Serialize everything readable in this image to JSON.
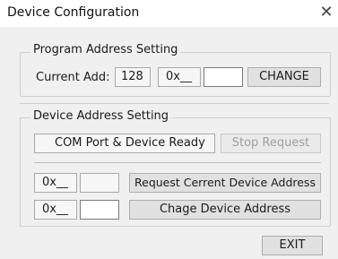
{
  "window": {
    "title": "Device Configuration",
    "close_label": "✕"
  },
  "program_group": {
    "title": "Program Address Setting",
    "current_label": "Current Add:",
    "current_value": "128",
    "hex_prefix": "0x__",
    "input_value": "",
    "change_label": "CHANGE"
  },
  "device_group": {
    "title": "Device Address Setting",
    "status_text": "COM Port & Device Ready",
    "stop_label": "Stop Request",
    "row1_hex_prefix": "0x__",
    "row1_value": "",
    "request_label": "Request Cerrent Device Address",
    "row2_hex_prefix": "0x__",
    "row2_value": "",
    "change_label": "Chage Device Address"
  },
  "footer": {
    "exit_label": "EXIT"
  }
}
